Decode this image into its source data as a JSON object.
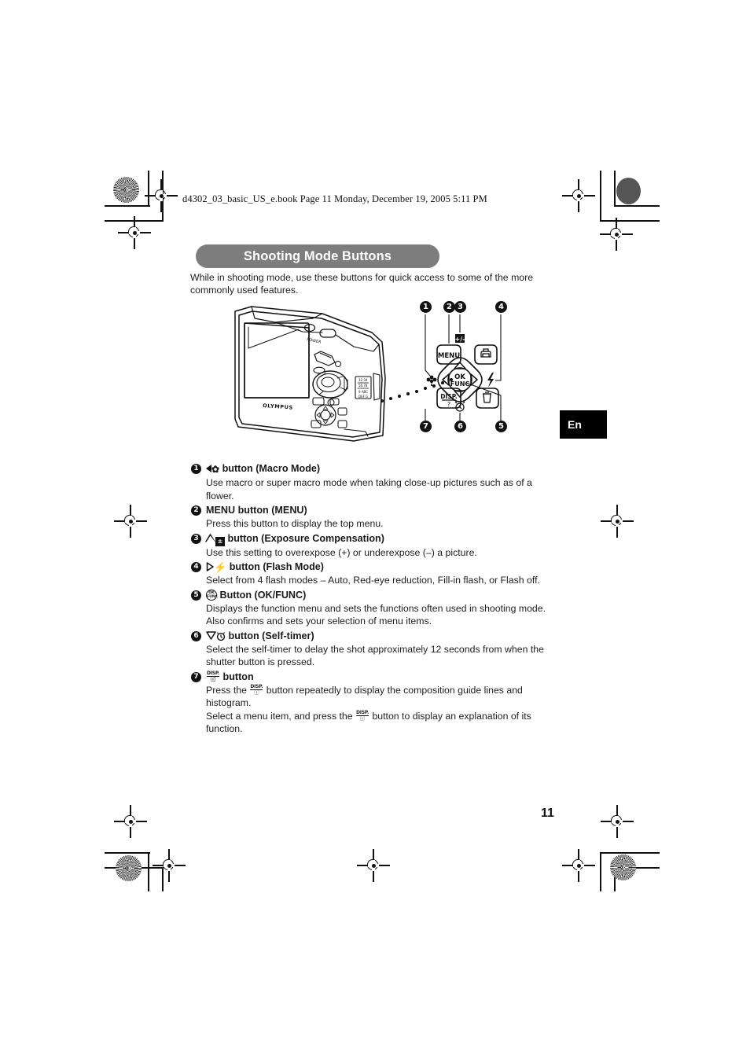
{
  "document": {
    "file_header": "d4302_03_basic_US_e.book  Page 11  Monday, December 19, 2005  5:11 PM",
    "page_number": "11",
    "language_tab": "En",
    "title": "Shooting Mode Buttons",
    "intro": "While in shooting mode, use these buttons for quick access to some of the more commonly used features.",
    "accent_color": "#7d7d7d",
    "title_text_color": "#ffffff",
    "tab_bg_color": "#000000"
  },
  "diagram": {
    "name": "camera-rear-view-with-button-callouts",
    "brand_label": "OLYMPUS",
    "power_label": "POWER",
    "pad_center_label_top": "OK",
    "pad_center_label_bottom": "FUNC",
    "menu_button_label": "MENU",
    "disp_label": "DISP.",
    "callouts": [
      {
        "num": "1",
        "target": "macro-button"
      },
      {
        "num": "2",
        "target": "menu-button"
      },
      {
        "num": "3",
        "target": "exposure-compensation-button"
      },
      {
        "num": "4",
        "target": "flash-button"
      },
      {
        "num": "5",
        "target": "print-erase-button"
      },
      {
        "num": "6",
        "target": "self-timer-button"
      },
      {
        "num": "7",
        "target": "disp-guide-button"
      }
    ]
  },
  "list": [
    {
      "num": "1",
      "icons": [
        "arrow-left-icon",
        "macro-flower-icon"
      ],
      "heading": "button (Macro Mode)",
      "body": [
        "Use macro or super macro mode when taking close-up pictures such as of a flower."
      ]
    },
    {
      "num": "2",
      "icons": [],
      "heading": "MENU button (MENU)",
      "body": [
        "Press this button to display the top menu."
      ]
    },
    {
      "num": "3",
      "icons": [
        "arrow-up-icon",
        "exposure-compensation-icon"
      ],
      "heading": "button (Exposure Compensation)",
      "body": [
        "Use this setting to overexpose (+) or underexpose (–) a picture."
      ]
    },
    {
      "num": "4",
      "icons": [
        "arrow-right-icon",
        "flash-bolt-icon"
      ],
      "heading": "button (Flash Mode)",
      "body": [
        "Select from 4 flash modes – Auto, Red-eye reduction, Fill-in flash, or Flash off."
      ]
    },
    {
      "num": "5",
      "icons": [
        "ok-func-icon"
      ],
      "heading": "Button (OK/FUNC)",
      "body": [
        "Displays the function menu and sets the functions often used in shooting mode.",
        "Also confirms and sets your selection of menu items."
      ]
    },
    {
      "num": "6",
      "icons": [
        "arrow-down-icon",
        "self-timer-icon"
      ],
      "heading": "button (Self-timer)",
      "body": [
        "Select the self-timer to delay the shot approximately 12 seconds from when the shutter button is pressed."
      ]
    },
    {
      "num": "7",
      "icons": [
        "disp-guide-icon"
      ],
      "heading": "button",
      "body": [
        "Press the   button repeatedly to display the composition guide lines and histogram.",
        "Select a menu item, and press the   button to display an explanation of its function."
      ],
      "body_inline_icon": "disp-guide-icon"
    }
  ]
}
